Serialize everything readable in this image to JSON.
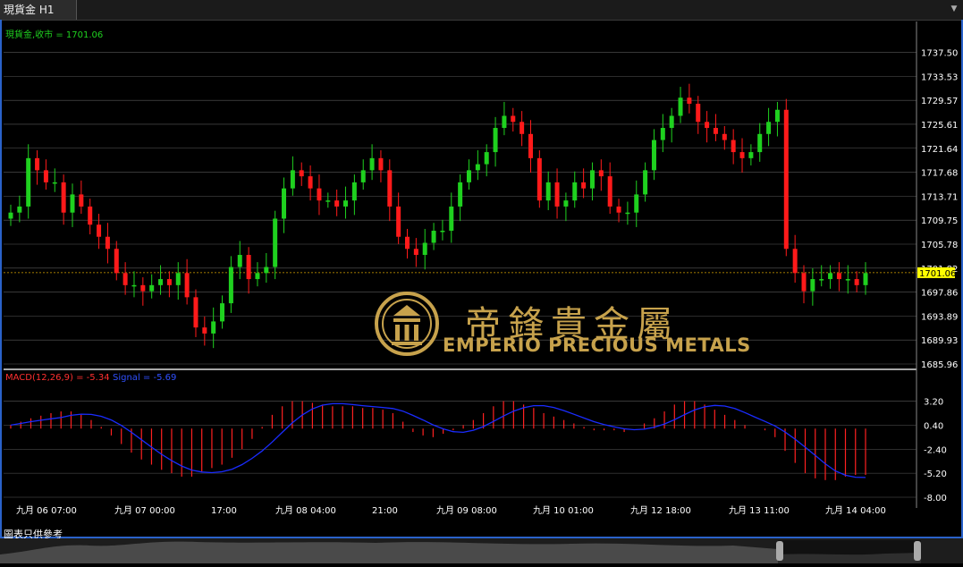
{
  "tab": {
    "title": "現貨金 H1",
    "menu_glyph": "▼"
  },
  "legend": {
    "main": "現貨金,收市 = 1701.06",
    "macd": "MACD(12,26,9) = -5.34",
    "signal": "Signal = -5.69"
  },
  "price_axis": {
    "labels": [
      "1737.50",
      "1733.53",
      "1729.57",
      "1725.61",
      "1721.64",
      "1717.68",
      "1713.71",
      "1709.75",
      "1705.78",
      "1701.82",
      "1697.86",
      "1693.89",
      "1689.93",
      "1685.96"
    ],
    "current_price": "1701.06"
  },
  "macd_axis": {
    "labels": [
      "3.20",
      "0.40",
      "-2.40",
      "-5.20",
      "-8.00"
    ]
  },
  "time_axis": {
    "labels": [
      "九月 06 07:00",
      "九月 07 00:00",
      "17:00",
      "九月 08 04:00",
      "21:00",
      "九月 09 08:00",
      "九月 10 01:00",
      "九月 12 18:00",
      "九月 13 11:00",
      "九月 14 04:00"
    ]
  },
  "logo": {
    "chinese": "帝鋒貴金屬",
    "english": "EMPERIO PRECIOUS METALS"
  },
  "footer": {
    "label": "圖表只供參考"
  },
  "colors": {
    "up": "#1fd11f",
    "down": "#ff1a1a",
    "macd_hist": "#ff2020",
    "signal": "#1a2cff",
    "grid": "#5a5a5a",
    "logo_gold": "#c7a24c",
    "frame": "#2a62c9"
  },
  "chart_data": {
    "type": "candlestick",
    "instrument": "現貨金",
    "timeframe": "H1",
    "close_series": [
      1711,
      1712,
      1720,
      1718,
      1716,
      1716,
      1711,
      1714,
      1712,
      1709,
      1707,
      1705,
      1701,
      1699,
      1699,
      1698,
      1699,
      1700,
      1699,
      1701,
      1697,
      1692,
      1691,
      1693,
      1696,
      1702,
      1704,
      1700,
      1701,
      1702,
      1710,
      1715,
      1718,
      1717,
      1715,
      1713,
      1713,
      1712,
      1713,
      1716,
      1718,
      1720,
      1718,
      1712,
      1707,
      1705,
      1704,
      1706,
      1708,
      1708,
      1712,
      1716,
      1718,
      1719,
      1721,
      1725,
      1727,
      1726,
      1724,
      1720,
      1713,
      1716,
      1712,
      1713,
      1716,
      1715,
      1718,
      1717,
      1712,
      1711,
      1711,
      1714,
      1718,
      1723,
      1725,
      1727,
      1730,
      1729,
      1726,
      1725,
      1724,
      1723,
      1721,
      1720,
      1721,
      1724,
      1726,
      1728,
      1705,
      1701,
      1698,
      1700,
      1700,
      1701,
      1700,
      1700,
      1699,
      1701
    ],
    "macd_hist": [
      0.4,
      0.8,
      1.2,
      1.5,
      1.8,
      2.0,
      2.0,
      1.6,
      1.0,
      0.2,
      -0.8,
      -1.8,
      -2.8,
      -3.6,
      -4.2,
      -4.8,
      -5.2,
      -5.6,
      -5.6,
      -5.0,
      -4.6,
      -4.2,
      -3.4,
      -2.4,
      -1.2,
      0.2,
      1.6,
      2.6,
      3.2,
      3.2,
      3.0,
      2.8,
      2.6,
      2.6,
      2.6,
      2.4,
      2.4,
      2.2,
      1.8,
      0.8,
      -0.4,
      -0.8,
      -1.0,
      -0.6,
      -0.2,
      0.4,
      1.0,
      1.8,
      2.6,
      3.2,
      3.2,
      2.8,
      2.4,
      1.8,
      1.4,
      1.0,
      0.6,
      0.2,
      -0.2,
      -0.2,
      -0.2,
      -0.4,
      0.0,
      0.6,
      1.2,
      2.0,
      2.8,
      3.2,
      3.2,
      2.8,
      2.2,
      1.6,
      1.0,
      0.4,
      0.0,
      -0.2,
      -1.0,
      -2.6,
      -4.0,
      -5.2,
      -5.8,
      -6.0,
      -6.0,
      -5.6,
      -5.4,
      -5.4
    ],
    "ylim": [
      1685.96,
      1739.5
    ],
    "macd_ylim": [
      -8.0,
      4.4
    ]
  }
}
